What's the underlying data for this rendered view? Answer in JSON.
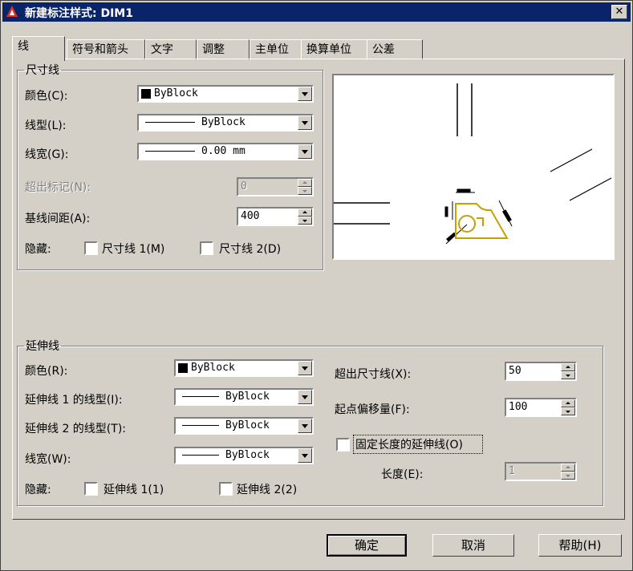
{
  "window": {
    "title": "新建标注样式: DIM1",
    "close_glyph": "✕"
  },
  "tabs": [
    "线",
    "符号和箭头",
    "文字",
    "调整",
    "主单位",
    "换算单位",
    "公差"
  ],
  "dim_line": {
    "group_label": "尺寸线",
    "color_label": "颜色(C):",
    "color_value": "ByBlock",
    "linetype_label": "线型(L):",
    "linetype_value": "ByBlock",
    "lineweight_label": "线宽(G):",
    "lineweight_value": "0.00 mm",
    "extend_ticks_label": "超出标记(N):",
    "extend_ticks_value": "0",
    "baseline_spacing_label": "基线间距(A):",
    "baseline_spacing_value": "400",
    "suppress_label": "隐藏:",
    "suppress_1": "尺寸线 1(M)",
    "suppress_2": "尺寸线 2(D)"
  },
  "ext_line": {
    "group_label": "延伸线",
    "color_label": "颜色(R):",
    "color_value": "ByBlock",
    "linetype1_label": "延伸线 1 的线型(I):",
    "linetype1_value": "ByBlock",
    "linetype2_label": "延伸线 2 的线型(T):",
    "linetype2_value": "ByBlock",
    "lineweight_label": "线宽(W):",
    "lineweight_value": "ByBlock",
    "suppress_label": "隐藏:",
    "suppress_1": "延伸线 1(1)",
    "suppress_2": "延伸线 2(2)",
    "beyond_label": "超出尺寸线(X):",
    "beyond_value": "50",
    "offset_label": "起点偏移量(F):",
    "offset_value": "100",
    "fixed_length_label": "固定长度的延伸线(O)",
    "length_label": "长度(E):",
    "length_value": "1"
  },
  "buttons": {
    "ok": "确定",
    "cancel": "取消",
    "help": "帮助(H)"
  },
  "colors": {
    "title_bar": "#0a246a",
    "dialog_bg": "#d4d0c8",
    "preview_shape": "#c8a000"
  }
}
